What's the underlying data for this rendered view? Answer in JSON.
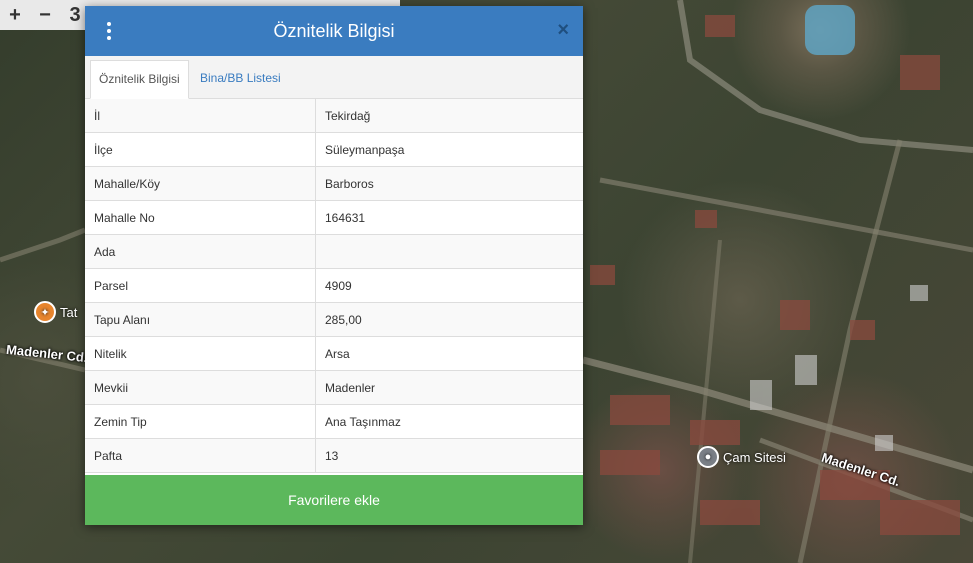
{
  "map": {
    "road_labels": [
      "Madenler Cd.",
      "Madenler Cd."
    ],
    "poi": [
      {
        "label": "Tat",
        "icon": "restaurant-icon"
      },
      {
        "label": "Çam Sitesi",
        "icon": "place-pin-icon"
      }
    ]
  },
  "toolbar": {
    "zoom_in": "+",
    "zoom_out": "−",
    "extra": "3"
  },
  "dialog": {
    "title": "Öznitelik Bilgisi",
    "close": "×",
    "tabs": [
      {
        "label": "Öznitelik Bilgisi",
        "active": true
      },
      {
        "label": "Bina/BB Listesi",
        "active": false
      }
    ],
    "rows": [
      {
        "key": "İl",
        "value": "Tekirdağ"
      },
      {
        "key": "İlçe",
        "value": "Süleymanpaşa"
      },
      {
        "key": "Mahalle/Köy",
        "value": "Barboros"
      },
      {
        "key": "Mahalle No",
        "value": "164631"
      },
      {
        "key": "Ada",
        "value": ""
      },
      {
        "key": "Parsel",
        "value": "4909"
      },
      {
        "key": "Tapu Alanı",
        "value": "285,00"
      },
      {
        "key": "Nitelik",
        "value": "Arsa"
      },
      {
        "key": "Mevkii",
        "value": "Madenler"
      },
      {
        "key": "Zemin Tip",
        "value": "Ana Taşınmaz"
      },
      {
        "key": "Pafta",
        "value": "13"
      }
    ],
    "favorite_button": "Favorilere ekle"
  },
  "colors": {
    "header": "#3a7cc0",
    "favorite": "#5cb85c",
    "poi_restaurant": "#e7852d"
  }
}
